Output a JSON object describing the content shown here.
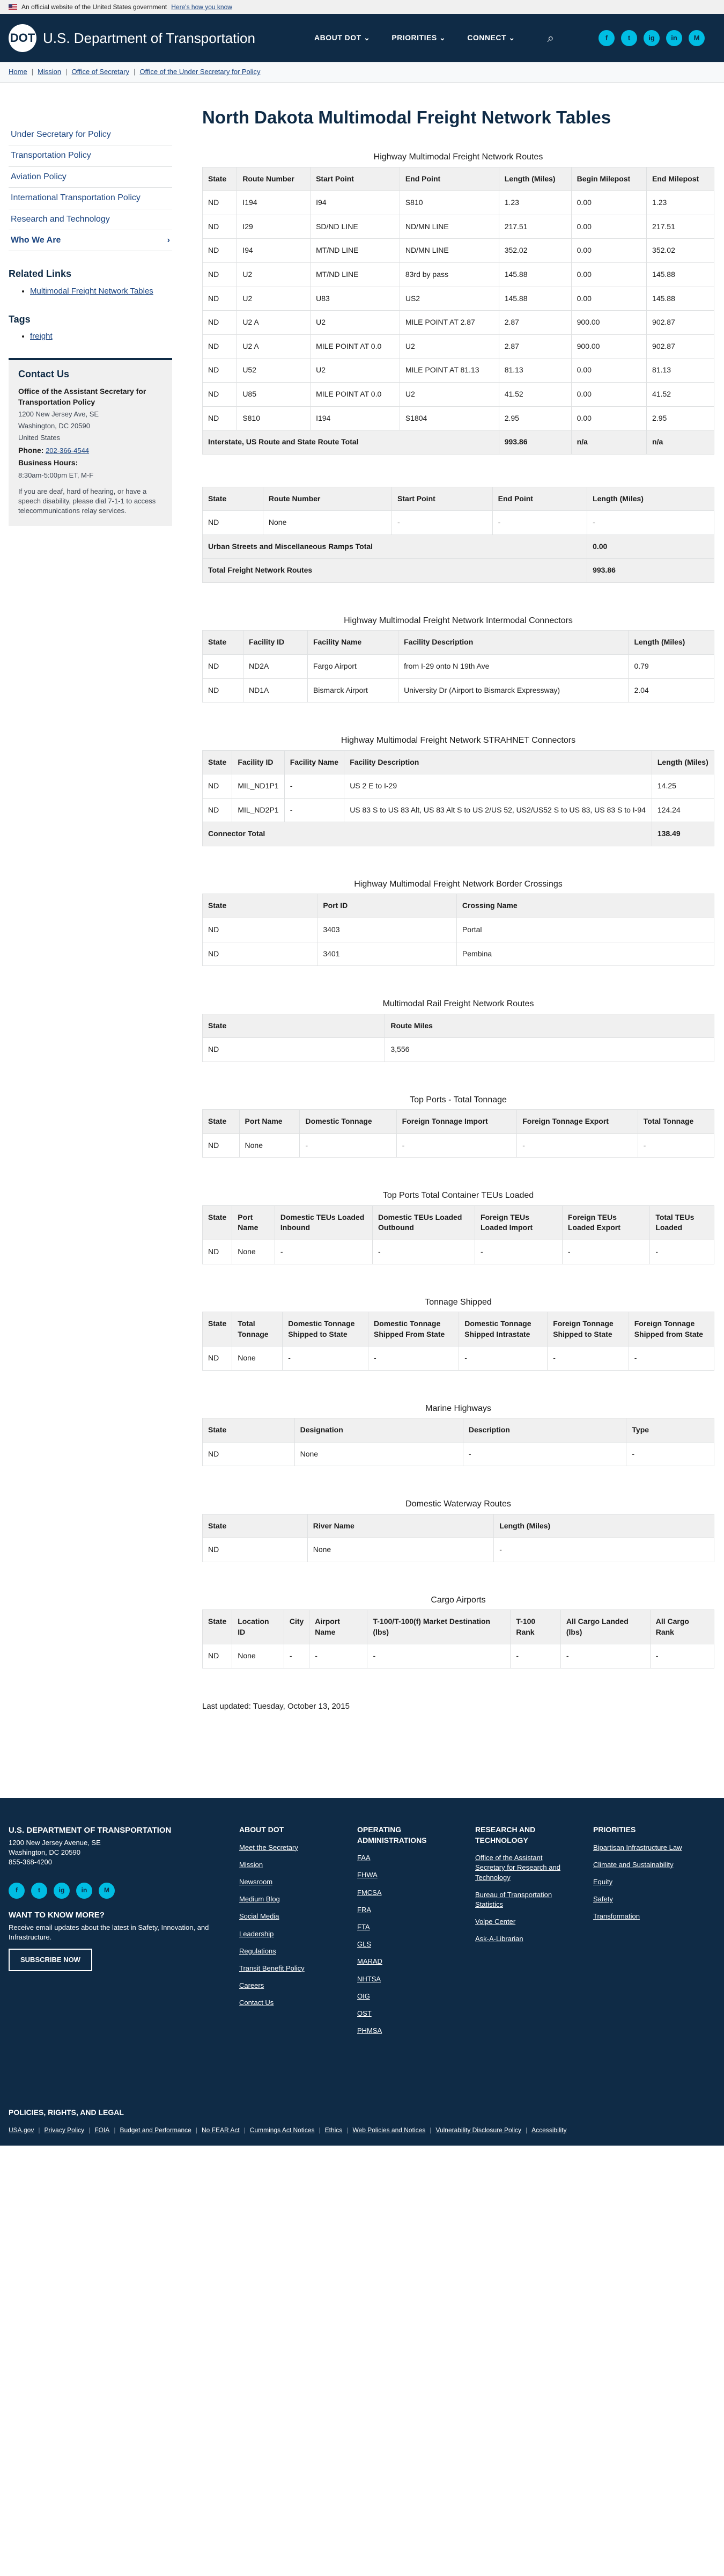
{
  "banner": {
    "text": "An official website of the United States government",
    "link": "Here's how you know"
  },
  "header": {
    "logo_text": "DOT",
    "title": "U.S. Department of Transportation",
    "nav": [
      "ABOUT DOT ⌄",
      "PRIORITIES ⌄",
      "CONNECT ⌄"
    ],
    "socials": [
      "f",
      "t",
      "ig",
      "in",
      "M"
    ]
  },
  "breadcrumb": [
    "Home",
    "Mission",
    "Office of Secretary",
    "Office of the Under Secretary for Policy"
  ],
  "sidebar": {
    "items": [
      "Under Secretary for Policy",
      "Transportation Policy",
      "Aviation Policy",
      "International Transportation Policy",
      "Research and Technology",
      "Who We Are"
    ],
    "related_heading": "Related Links",
    "related_links": [
      "Multimodal Freight Network Tables"
    ],
    "tags_heading": "Tags",
    "tags": [
      "freight"
    ],
    "contact": {
      "heading": "Contact Us",
      "office": "Office of the Assistant Secretary for Transportation Policy",
      "address1": "1200 New Jersey Ave, SE",
      "address2": "Washington, DC 20590",
      "country": "United States",
      "phone_label": "Phone:",
      "phone": "202-366-4544",
      "hours_label": "Business Hours:",
      "hours": "8:30am-5:00pm ET, M-F",
      "note": "If you are deaf, hard of hearing, or have a speech disability, please dial 7-1-1 to access telecommunications relay services."
    }
  },
  "page": {
    "title": "North Dakota Multimodal Freight Network Tables",
    "updated": "Last updated: Tuesday, October 13, 2015"
  },
  "tables": [
    {
      "title": "Highway Multimodal Freight Network Routes",
      "headers": [
        "State",
        "Route Number",
        "Start Point",
        "End Point",
        "Length (Miles)",
        "Begin Milepost",
        "End Milepost"
      ],
      "rows": [
        [
          "ND",
          "I194",
          "I94",
          "S810",
          "1.23",
          "0.00",
          "1.23"
        ],
        [
          "ND",
          "I29",
          "SD/ND LINE",
          "ND/MN LINE",
          "217.51",
          "0.00",
          "217.51"
        ],
        [
          "ND",
          "I94",
          "MT/ND LINE",
          "ND/MN LINE",
          "352.02",
          "0.00",
          "352.02"
        ],
        [
          "ND",
          "U2",
          "MT/ND LINE",
          "83rd by pass",
          "145.88",
          "0.00",
          "145.88"
        ],
        [
          "ND",
          "U2",
          "U83",
          "US2",
          "145.88",
          "0.00",
          "145.88"
        ],
        [
          "ND",
          "U2 A",
          "U2",
          "MILE POINT AT 2.87",
          "2.87",
          "900.00",
          "902.87"
        ],
        [
          "ND",
          "U2 A",
          "MILE POINT AT 0.0",
          "U2",
          "2.87",
          "900.00",
          "902.87"
        ],
        [
          "ND",
          "U52",
          "U2",
          "MILE POINT AT 81.13",
          "81.13",
          "0.00",
          "81.13"
        ],
        [
          "ND",
          "U85",
          "MILE POINT AT 0.0",
          "U2",
          "41.52",
          "0.00",
          "41.52"
        ],
        [
          "ND",
          "S810",
          "I194",
          "S1804",
          "2.95",
          "0.00",
          "2.95"
        ]
      ],
      "totals": [
        [
          "Interstate, US Route and State Route Total",
          "993.86",
          "n/a",
          "n/a"
        ]
      ]
    },
    {
      "title": "",
      "headers": [
        "State",
        "Route Number",
        "Start Point",
        "End Point",
        "Length (Miles)"
      ],
      "rows": [
        [
          "ND",
          "None",
          "-",
          "-",
          "-"
        ]
      ],
      "totals": [
        [
          "Urban Streets and Miscellaneous Ramps Total",
          "0.00"
        ],
        [
          "Total Freight Network Routes",
          "993.86"
        ]
      ]
    },
    {
      "title": "Highway Multimodal Freight Network Intermodal Connectors",
      "headers": [
        "State",
        "Facility ID",
        "Facility Name",
        "Facility Description",
        "Length (Miles)"
      ],
      "rows": [
        [
          "ND",
          "ND2A",
          "Fargo Airport",
          "from I-29 onto N 19th Ave",
          "0.79"
        ],
        [
          "ND",
          "ND1A",
          "Bismarck Airport",
          "University Dr (Airport to Bismarck Expressway)",
          "2.04"
        ]
      ]
    },
    {
      "title": "Highway Multimodal Freight Network STRAHNET Connectors",
      "headers": [
        "State",
        "Facility ID",
        "Facility Name",
        "Facility Description",
        "Length (Miles)"
      ],
      "rows": [
        [
          "ND",
          "MIL_ND1P1",
          "-",
          "US 2 E to I-29",
          "14.25"
        ],
        [
          "ND",
          "MIL_ND2P1",
          "-",
          "US 83 S to US 83 Alt, US 83 Alt S to US 2/US 52, US2/US52 S to US 83, US 83 S to I-94",
          "124.24"
        ]
      ],
      "totals": [
        [
          "Connector Total",
          "138.49"
        ]
      ]
    },
    {
      "title": "Highway Multimodal Freight Network Border Crossings",
      "headers": [
        "State",
        "Port ID",
        "Crossing Name"
      ],
      "rows": [
        [
          "ND",
          "3403",
          "Portal"
        ],
        [
          "ND",
          "3401",
          "Pembina"
        ]
      ]
    },
    {
      "title": "Multimodal Rail Freight Network Routes",
      "headers": [
        "State",
        "Route Miles"
      ],
      "rows": [
        [
          "ND",
          "3,556"
        ]
      ]
    },
    {
      "title": "Top Ports - Total Tonnage",
      "headers": [
        "State",
        "Port Name",
        "Domestic Tonnage",
        "Foreign Tonnage Import",
        "Foreign Tonnage Export",
        "Total Tonnage"
      ],
      "rows": [
        [
          "ND",
          "None",
          "-",
          "-",
          "-",
          "-"
        ]
      ]
    },
    {
      "title": "Top Ports Total Container TEUs Loaded",
      "headers": [
        "State",
        "Port Name",
        "Domestic TEUs Loaded Inbound",
        "Domestic TEUs Loaded Outbound",
        "Foreign TEUs Loaded Import",
        "Foreign TEUs Loaded Export",
        "Total TEUs Loaded"
      ],
      "rows": [
        [
          "ND",
          "None",
          "-",
          "-",
          "-",
          "-",
          "-"
        ]
      ]
    },
    {
      "title": "Tonnage Shipped",
      "headers": [
        "State",
        "Total Tonnage",
        "Domestic Tonnage Shipped to State",
        "Domestic Tonnage Shipped From State",
        "Domestic Tonnage Shipped Intrastate",
        "Foreign Tonnage Shipped to State",
        "Foreign Tonnage Shipped from State"
      ],
      "rows": [
        [
          "ND",
          "None",
          "-",
          "-",
          "-",
          "-",
          "-"
        ]
      ]
    },
    {
      "title": "Marine Highways",
      "headers": [
        "State",
        "Designation",
        "Description",
        "Type"
      ],
      "rows": [
        [
          "ND",
          "None",
          "-",
          "-"
        ]
      ]
    },
    {
      "title": "Domestic Waterway Routes",
      "headers": [
        "State",
        "River Name",
        "Length (Miles)"
      ],
      "rows": [
        [
          "ND",
          "None",
          "-"
        ]
      ]
    },
    {
      "title": "Cargo Airports",
      "headers": [
        "State",
        "Location ID",
        "City",
        "Airport Name",
        "T-100/T-100(f) Market Destination (lbs)",
        "T-100 Rank",
        "All Cargo Landed (lbs)",
        "All Cargo Rank"
      ],
      "rows": [
        [
          "ND",
          "None",
          "-",
          "-",
          "-",
          "-",
          "-",
          "-"
        ]
      ]
    }
  ],
  "footer": {
    "org": "U.S. DEPARTMENT OF TRANSPORTATION",
    "address1": "1200 New Jersey Avenue, SE",
    "address2": "Washington, DC 20590",
    "phone": "855-368-4200",
    "want_heading": "WANT TO KNOW MORE?",
    "want_text": "Receive email updates about the latest in Safety, Innovation, and Infrastructure.",
    "subscribe": "SUBSCRIBE NOW",
    "columns": [
      {
        "heading": "ABOUT DOT",
        "links": [
          "Meet the Secretary",
          "Mission",
          "Newsroom",
          "Medium Blog",
          "Social Media",
          "Leadership",
          "Regulations",
          "Transit Benefit Policy",
          "Careers",
          "Contact Us"
        ]
      },
      {
        "heading": "OPERATING ADMINISTRATIONS",
        "links": [
          "FAA",
          "FHWA",
          "FMCSA",
          "FRA",
          "FTA",
          "GLS",
          "MARAD",
          "NHTSA",
          "OIG",
          "OST",
          "PHMSA"
        ]
      },
      {
        "heading": "RESEARCH AND TECHNOLOGY",
        "links": [
          "Office of the Assistant Secretary for Research and Technology",
          "Bureau of Transportation Statistics",
          "Volpe Center",
          "Ask-A-Librarian"
        ]
      },
      {
        "heading": "PRIORITIES",
        "links": [
          "Bipartisan Infrastructure Law",
          "Climate and Sustainability",
          "Equity",
          "Safety",
          "Transformation"
        ]
      }
    ],
    "policies_heading": "POLICIES, RIGHTS, AND LEGAL",
    "policy_links": [
      "USA.gov",
      "Privacy Policy",
      "FOIA",
      "Budget and Performance",
      "No FEAR Act",
      "Cummings Act Notices",
      "Ethics",
      "Web Policies and Notices",
      "Vulnerability Disclosure Policy",
      "Accessibility"
    ]
  }
}
